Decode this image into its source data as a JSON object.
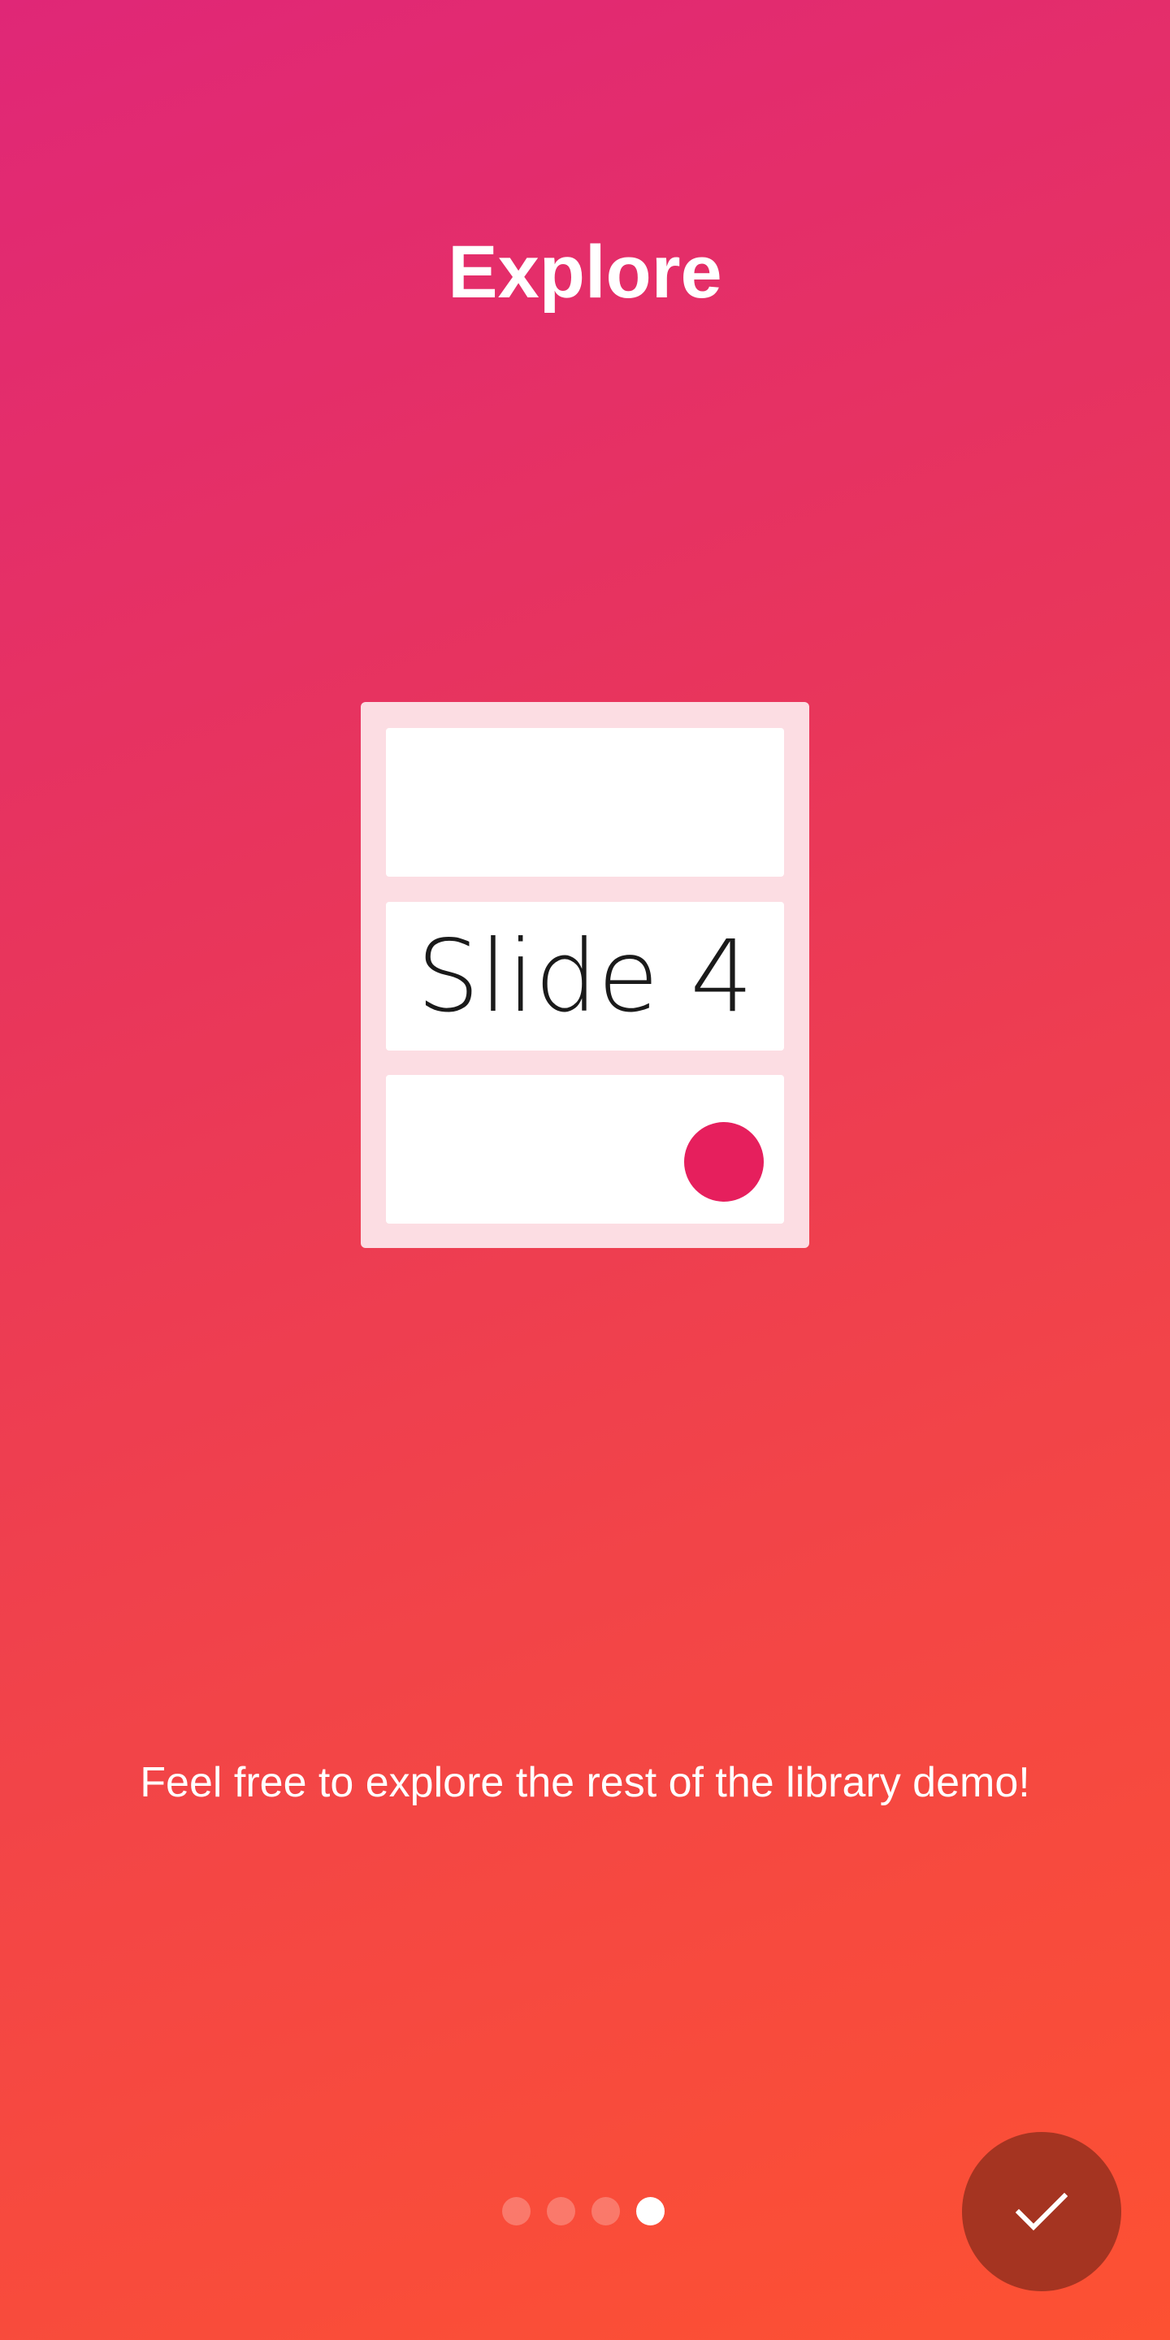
{
  "slide": {
    "title": "Explore",
    "description": "Feel free to explore the rest of the library demo!",
    "illustration_label": "Slide 4"
  },
  "pager": {
    "total": 4,
    "active_index": 3
  },
  "done_button": {
    "icon": "check-icon"
  },
  "colors": {
    "gradient_start": "#e02777",
    "gradient_end": "#fd5132",
    "done_button_bg": "#a53421",
    "illustration_dot": "#e61f5d"
  }
}
